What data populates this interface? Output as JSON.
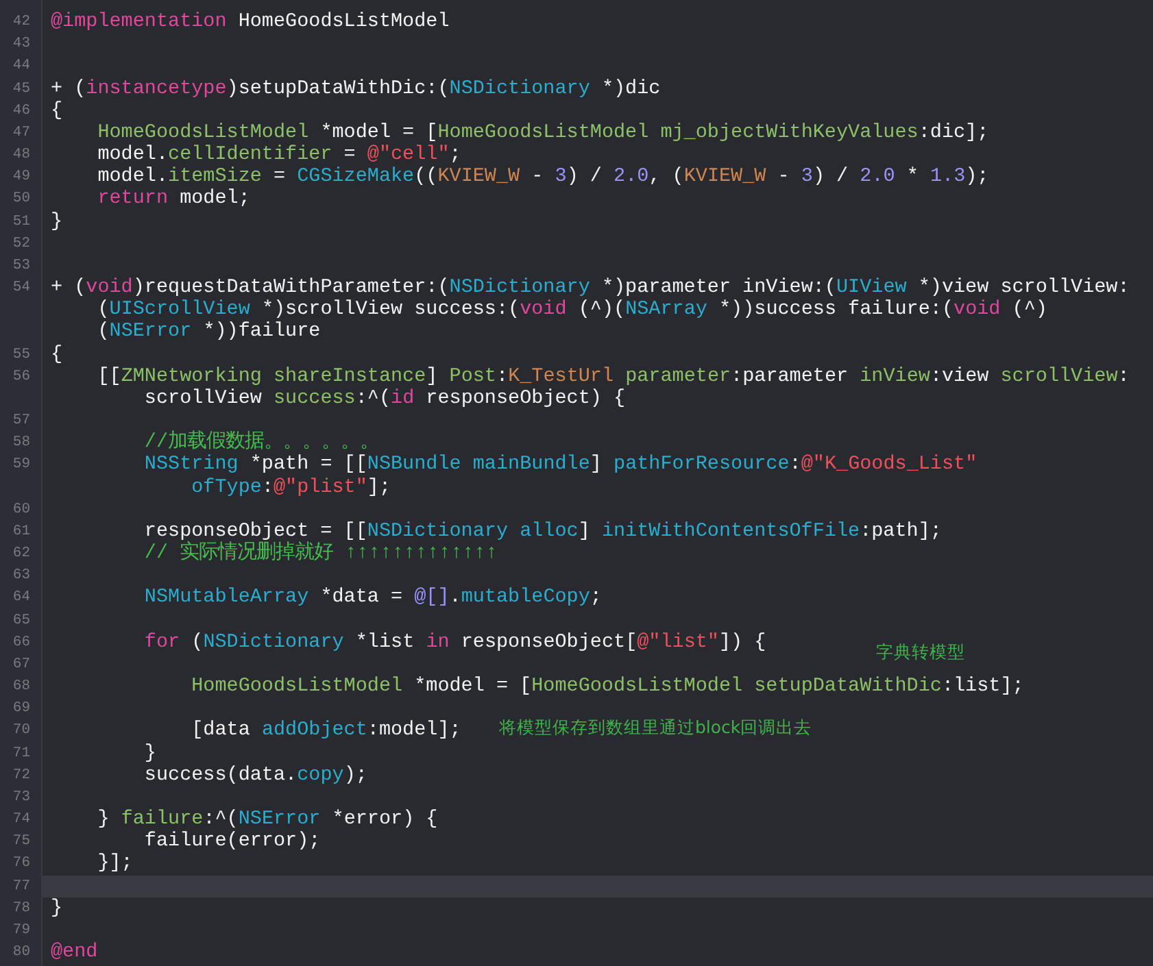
{
  "editor": {
    "lines": [
      {
        "number": "42",
        "current": false,
        "rows": [
          {
            "segments": [
              {
                "kind": "kw",
                "text": "@implementation"
              },
              {
                "kind": "plain",
                "text": " HomeGoodsListModel"
              }
            ]
          }
        ]
      },
      {
        "number": "43",
        "current": false
      },
      {
        "number": "44",
        "current": false
      },
      {
        "number": "45",
        "current": false,
        "rows": [
          {
            "segments": [
              {
                "kind": "plain",
                "text": "+ ("
              },
              {
                "kind": "kw",
                "text": "instancetype"
              },
              {
                "kind": "plain",
                "text": ")setupDataWithDic:("
              },
              {
                "kind": "sys",
                "text": "NSDictionary"
              },
              {
                "kind": "plain",
                "text": " *)dic"
              }
            ]
          }
        ]
      },
      {
        "number": "46",
        "current": false,
        "rows": [
          {
            "segments": [
              {
                "kind": "plain",
                "text": "{"
              }
            ]
          }
        ]
      },
      {
        "number": "47",
        "current": false,
        "rows": [
          {
            "segments": [
              {
                "kind": "proj",
                "text": "    HomeGoodsListModel"
              },
              {
                "kind": "plain",
                "text": " *model = ["
              },
              {
                "kind": "proj",
                "text": "HomeGoodsListModel"
              },
              {
                "kind": "proj",
                "text": " mj_objectWithKeyValues"
              },
              {
                "kind": "plain",
                "text": ":dic];"
              }
            ]
          }
        ]
      },
      {
        "number": "48",
        "current": false,
        "rows": [
          {
            "segments": [
              {
                "kind": "plain",
                "text": "    model."
              },
              {
                "kind": "proj",
                "text": "cellIdentifier"
              },
              {
                "kind": "plain",
                "text": " = "
              },
              {
                "kind": "str",
                "text": "@\"cell\""
              },
              {
                "kind": "plain",
                "text": ";"
              }
            ]
          }
        ]
      },
      {
        "number": "49",
        "current": false,
        "rows": [
          {
            "segments": [
              {
                "kind": "plain",
                "text": "    model."
              },
              {
                "kind": "proj",
                "text": "itemSize"
              },
              {
                "kind": "plain",
                "text": " = "
              },
              {
                "kind": "sys",
                "text": "CGSizeMake"
              },
              {
                "kind": "plain",
                "text": "(("
              },
              {
                "kind": "macro",
                "text": "KVIEW_W"
              },
              {
                "kind": "plain",
                "text": " - "
              },
              {
                "kind": "num",
                "text": "3"
              },
              {
                "kind": "plain",
                "text": ") / "
              },
              {
                "kind": "num",
                "text": "2.0"
              },
              {
                "kind": "plain",
                "text": ", ("
              },
              {
                "kind": "macro",
                "text": "KVIEW_W"
              },
              {
                "kind": "plain",
                "text": " - "
              },
              {
                "kind": "num",
                "text": "3"
              },
              {
                "kind": "plain",
                "text": ") / "
              },
              {
                "kind": "num",
                "text": "2.0"
              },
              {
                "kind": "plain",
                "text": " * "
              },
              {
                "kind": "num",
                "text": "1.3"
              },
              {
                "kind": "plain",
                "text": ");"
              }
            ]
          }
        ]
      },
      {
        "number": "50",
        "current": false,
        "rows": [
          {
            "segments": [
              {
                "kind": "kw",
                "text": "    return"
              },
              {
                "kind": "plain",
                "text": " model;"
              }
            ]
          }
        ]
      },
      {
        "number": "51",
        "current": false,
        "rows": [
          {
            "segments": [
              {
                "kind": "plain",
                "text": "}"
              }
            ]
          }
        ]
      },
      {
        "number": "52",
        "current": false
      },
      {
        "number": "53",
        "current": false
      },
      {
        "number": "54",
        "current": false,
        "rows": [
          {
            "segments": [
              {
                "kind": "plain",
                "text": "+ ("
              },
              {
                "kind": "kw",
                "text": "void"
              },
              {
                "kind": "plain",
                "text": ")requestDataWithParameter:("
              },
              {
                "kind": "sys",
                "text": "NSDictionary"
              },
              {
                "kind": "plain",
                "text": " *)parameter inView:("
              },
              {
                "kind": "sys",
                "text": "UIView"
              },
              {
                "kind": "plain",
                "text": " *)view scrollView:"
              }
            ]
          },
          {
            "segments": [
              {
                "kind": "plain",
                "text": "    ("
              },
              {
                "kind": "sys",
                "text": "UIScrollView"
              },
              {
                "kind": "plain",
                "text": " *)scrollView success:("
              },
              {
                "kind": "kw",
                "text": "void"
              },
              {
                "kind": "plain",
                "text": " (^)("
              },
              {
                "kind": "sys",
                "text": "NSArray"
              },
              {
                "kind": "plain",
                "text": " *))success failure:("
              },
              {
                "kind": "kw",
                "text": "void"
              },
              {
                "kind": "plain",
                "text": " (^)"
              }
            ]
          },
          {
            "segments": [
              {
                "kind": "plain",
                "text": "    ("
              },
              {
                "kind": "sys",
                "text": "NSError"
              },
              {
                "kind": "plain",
                "text": " *))failure"
              }
            ]
          }
        ]
      },
      {
        "number": "55",
        "current": false,
        "rows": [
          {
            "segments": [
              {
                "kind": "plain",
                "text": "{"
              }
            ]
          }
        ]
      },
      {
        "number": "56",
        "current": false,
        "rows": [
          {
            "segments": [
              {
                "kind": "plain",
                "text": "    [["
              },
              {
                "kind": "proj",
                "text": "ZMNetworking"
              },
              {
                "kind": "proj",
                "text": " shareInstance"
              },
              {
                "kind": "plain",
                "text": "] "
              },
              {
                "kind": "proj",
                "text": "Post"
              },
              {
                "kind": "plain",
                "text": ":"
              },
              {
                "kind": "macro",
                "text": "K_TestUrl"
              },
              {
                "kind": "proj",
                "text": " parameter"
              },
              {
                "kind": "plain",
                "text": ":parameter "
              },
              {
                "kind": "proj",
                "text": "inView"
              },
              {
                "kind": "plain",
                "text": ":view "
              },
              {
                "kind": "proj",
                "text": "scrollView"
              },
              {
                "kind": "plain",
                "text": ":"
              }
            ]
          },
          {
            "segments": [
              {
                "kind": "plain",
                "text": "        scrollView "
              },
              {
                "kind": "proj",
                "text": "success"
              },
              {
                "kind": "plain",
                "text": ":^("
              },
              {
                "kind": "kw",
                "text": "id"
              },
              {
                "kind": "plain",
                "text": " responseObject) {"
              }
            ]
          }
        ]
      },
      {
        "number": "57",
        "current": false
      },
      {
        "number": "58",
        "current": false,
        "rows": [
          {
            "segments": [
              {
                "kind": "comment",
                "text": "        //加载假数据。。。。。。"
              }
            ]
          }
        ]
      },
      {
        "number": "59",
        "current": false,
        "rows": [
          {
            "segments": [
              {
                "kind": "sys",
                "text": "        NSString"
              },
              {
                "kind": "plain",
                "text": " *path = [["
              },
              {
                "kind": "sys",
                "text": "NSBundle"
              },
              {
                "kind": "sys",
                "text": " mainBundle"
              },
              {
                "kind": "plain",
                "text": "] "
              },
              {
                "kind": "sys",
                "text": "pathForResource"
              },
              {
                "kind": "plain",
                "text": ":"
              },
              {
                "kind": "str",
                "text": "@\"K_Goods_List\""
              }
            ]
          },
          {
            "segments": [
              {
                "kind": "sys",
                "text": "            ofType"
              },
              {
                "kind": "plain",
                "text": ":"
              },
              {
                "kind": "str",
                "text": "@\"plist\""
              },
              {
                "kind": "plain",
                "text": "];"
              }
            ]
          }
        ]
      },
      {
        "number": "60",
        "current": false
      },
      {
        "number": "61",
        "current": false,
        "rows": [
          {
            "segments": [
              {
                "kind": "plain",
                "text": "        responseObject = [["
              },
              {
                "kind": "sys",
                "text": "NSDictionary"
              },
              {
                "kind": "sys",
                "text": " alloc"
              },
              {
                "kind": "plain",
                "text": "] "
              },
              {
                "kind": "sys",
                "text": "initWithContentsOfFile"
              },
              {
                "kind": "plain",
                "text": ":path];"
              }
            ]
          }
        ]
      },
      {
        "number": "62",
        "current": false,
        "rows": [
          {
            "segments": [
              {
                "kind": "comment",
                "text": "        // 实际情况删掉就好 ↑↑↑↑↑↑↑↑↑↑↑↑↑"
              }
            ]
          }
        ]
      },
      {
        "number": "63",
        "current": false
      },
      {
        "number": "64",
        "current": false,
        "rows": [
          {
            "segments": [
              {
                "kind": "sys",
                "text": "        NSMutableArray"
              },
              {
                "kind": "plain",
                "text": " *data = "
              },
              {
                "kind": "num",
                "text": "@[]"
              },
              {
                "kind": "plain",
                "text": "."
              },
              {
                "kind": "sys",
                "text": "mutableCopy"
              },
              {
                "kind": "plain",
                "text": ";"
              }
            ]
          }
        ]
      },
      {
        "number": "65",
        "current": false
      },
      {
        "number": "66",
        "current": false,
        "note": "字典转模型",
        "rows": [
          {
            "segments": [
              {
                "kind": "kw",
                "text": "        for"
              },
              {
                "kind": "plain",
                "text": " ("
              },
              {
                "kind": "sys",
                "text": "NSDictionary"
              },
              {
                "kind": "plain",
                "text": " *list "
              },
              {
                "kind": "kw",
                "text": "in"
              },
              {
                "kind": "plain",
                "text": " responseObject["
              },
              {
                "kind": "str",
                "text": "@\"list\""
              },
              {
                "kind": "plain",
                "text": "]) {"
              }
            ]
          }
        ]
      },
      {
        "number": "67",
        "current": false
      },
      {
        "number": "68",
        "current": false,
        "rows": [
          {
            "segments": [
              {
                "kind": "proj",
                "text": "            HomeGoodsListModel"
              },
              {
                "kind": "plain",
                "text": " *model = ["
              },
              {
                "kind": "proj",
                "text": "HomeGoodsListModel"
              },
              {
                "kind": "proj",
                "text": " setupDataWithDic"
              },
              {
                "kind": "plain",
                "text": ":list];"
              }
            ]
          }
        ]
      },
      {
        "number": "69",
        "current": false
      },
      {
        "number": "70",
        "current": false,
        "note": "将模型保存到数组里通过block回调出去",
        "rows": [
          {
            "segments": [
              {
                "kind": "plain",
                "text": "            [data "
              },
              {
                "kind": "sys",
                "text": "addObject"
              },
              {
                "kind": "plain",
                "text": ":model];"
              }
            ]
          }
        ]
      },
      {
        "number": "71",
        "current": false,
        "rows": [
          {
            "segments": [
              {
                "kind": "plain",
                "text": "        }"
              }
            ]
          }
        ]
      },
      {
        "number": "72",
        "current": false,
        "rows": [
          {
            "segments": [
              {
                "kind": "plain",
                "text": "        success(data."
              },
              {
                "kind": "sys",
                "text": "copy"
              },
              {
                "kind": "plain",
                "text": ");"
              }
            ]
          }
        ]
      },
      {
        "number": "73",
        "current": false
      },
      {
        "number": "74",
        "current": false,
        "rows": [
          {
            "segments": [
              {
                "kind": "plain",
                "text": "    } "
              },
              {
                "kind": "proj",
                "text": "failure"
              },
              {
                "kind": "plain",
                "text": ":^("
              },
              {
                "kind": "sys",
                "text": "NSError"
              },
              {
                "kind": "plain",
                "text": " *error) {"
              }
            ]
          }
        ]
      },
      {
        "number": "75",
        "current": false,
        "rows": [
          {
            "segments": [
              {
                "kind": "plain",
                "text": "        failure(error);"
              }
            ]
          }
        ]
      },
      {
        "number": "76",
        "current": false,
        "rows": [
          {
            "segments": [
              {
                "kind": "plain",
                "text": "    }];"
              }
            ]
          }
        ]
      },
      {
        "number": "77",
        "current": true
      },
      {
        "number": "78",
        "current": false,
        "rows": [
          {
            "segments": [
              {
                "kind": "plain",
                "text": "}"
              }
            ]
          }
        ]
      },
      {
        "number": "79",
        "current": false
      },
      {
        "number": "80",
        "current": false,
        "rows": [
          {
            "segments": [
              {
                "kind": "kw",
                "text": "@end"
              }
            ]
          }
        ]
      }
    ]
  }
}
